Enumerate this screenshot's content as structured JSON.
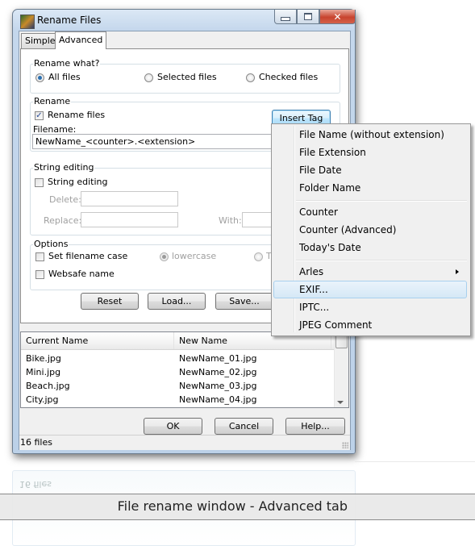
{
  "window": {
    "title": "Rename Files",
    "icon": "app-portrait-icon",
    "controls": {
      "minimize": "minimize-icon",
      "maximize": "maximize-icon",
      "close": "✕"
    }
  },
  "tabs": [
    {
      "label": "Simple",
      "active": false
    },
    {
      "label": "Advanced",
      "active": true
    }
  ],
  "rename_what": {
    "label": "Rename what?",
    "options": [
      {
        "label": "All files",
        "checked": true
      },
      {
        "label": "Selected files",
        "checked": false
      },
      {
        "label": "Checked files",
        "checked": false
      }
    ]
  },
  "rename": {
    "label": "Rename",
    "rename_files_label": "Rename files",
    "rename_files_checked": true,
    "insert_tag_label": "Insert Tag",
    "filename_label": "Filename:",
    "filename_value": "NewName_<counter>.<extension>"
  },
  "string_editing": {
    "label": "String editing",
    "checkbox_label": "String editing",
    "checked": false,
    "delete_label": "Delete:",
    "delete_value": "",
    "replace_label": "Replace:",
    "replace_value": "",
    "with_label": "With:",
    "with_value": ""
  },
  "options": {
    "label": "Options",
    "set_case_label": "Set filename case",
    "set_case_checked": false,
    "case_options": [
      {
        "label": "lowercase",
        "checked": true
      },
      {
        "label": "Ti",
        "checked": false
      }
    ],
    "websafe_label": "Websafe name",
    "websafe_checked": false
  },
  "actions": {
    "reset": "Reset",
    "load": "Load...",
    "save": "Save..."
  },
  "file_list": {
    "columns": [
      "Current Name",
      "New Name"
    ],
    "rows": [
      [
        "Bike.jpg",
        "NewName_01.jpg"
      ],
      [
        "Mini.jpg",
        "NewName_02.jpg"
      ],
      [
        "Beach.jpg",
        "NewName_03.jpg"
      ],
      [
        "City.jpg",
        "NewName_04.jpg"
      ]
    ]
  },
  "dialog_buttons": {
    "ok": "OK",
    "cancel": "Cancel",
    "help": "Help..."
  },
  "status": {
    "text": "16 files"
  },
  "insert_tag_menu": {
    "groups": [
      [
        "File Name (without extension)",
        "File Extension",
        "File Date",
        "Folder Name"
      ],
      [
        "Counter",
        "Counter (Advanced)",
        "Today's Date"
      ],
      [
        "Arles",
        "EXIF...",
        "IPTC...",
        "JPEG Comment"
      ]
    ],
    "submenu_item": "Arles",
    "highlighted_item": "EXIF..."
  },
  "caption": "File rename window - Advanced tab",
  "reflection": {
    "status_text": "16 files"
  }
}
